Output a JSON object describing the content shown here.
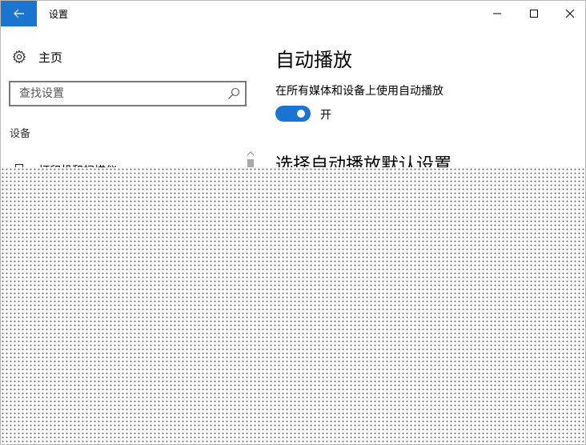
{
  "window": {
    "title": "设置",
    "controls": {
      "minimize_icon": "minimize-icon",
      "maximize_icon": "maximize-icon",
      "close_icon": "close-icon"
    }
  },
  "sidebar": {
    "home_label": "主页",
    "search": {
      "placeholder": "查找设置",
      "value": ""
    },
    "section_label": "设备",
    "items": [
      {
        "label": "打印机和扫描仪",
        "icon": "printer-icon"
      }
    ]
  },
  "main": {
    "title": "自动播放",
    "autoplay_setting_label": "在所有媒体和设备上使用自动播放",
    "toggle_state": "开",
    "toggle_on": true,
    "subheading": "选择自动播放默认设置"
  },
  "colors": {
    "accent": "#1a75d1",
    "text": "#000000",
    "border": "#7a7a7a"
  }
}
